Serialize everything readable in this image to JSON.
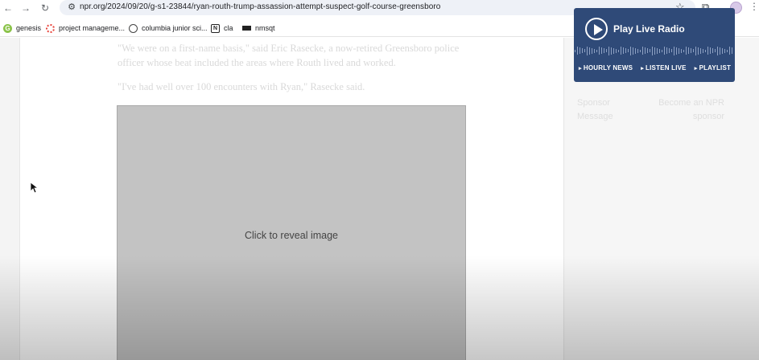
{
  "browser": {
    "url": "npr.org/2024/09/20/g-s1-23844/ryan-routh-trump-assassion-attempt-suspect-golf-course-greensboro",
    "bookmarks": [
      {
        "label": "genesis",
        "icon": "genesis-icon"
      },
      {
        "label": "project manageme...",
        "icon": "project-management-icon"
      },
      {
        "label": "columbia junior sci...",
        "icon": "globe-icon"
      },
      {
        "label": "cla",
        "icon": "notion-icon"
      },
      {
        "label": "nmsqt",
        "icon": "nmsqt-icon"
      }
    ]
  },
  "article": {
    "paragraph1": "\"We were on a first-name basis,\" said Eric Rasecke, a now-retired Greensboro police officer whose beat included the areas where Routh lived and worked.",
    "paragraph2": "\"I've had well over 100 encounters with Ryan,\" Rasecke said.",
    "image_placeholder": "Click to reveal image"
  },
  "sidebar": {
    "radio": {
      "title": "Play Live Radio",
      "links": [
        "HOURLY NEWS",
        "LISTEN LIVE",
        "PLAYLIST"
      ]
    },
    "sponsor_message": "Sponsor Message",
    "become_sponsor": "Become an NPR sponsor"
  },
  "colors": {
    "radio_bg": "#2f4a78",
    "image_bg": "#c3c3c3"
  }
}
